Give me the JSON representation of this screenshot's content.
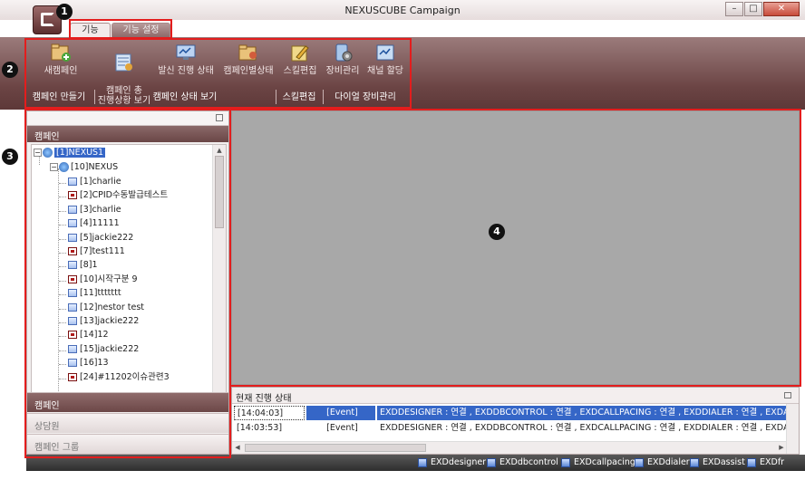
{
  "window": {
    "title": "NEXUSCUBE Campaign",
    "controls": {
      "minimize": "–",
      "maximize": "□",
      "close": "✕"
    }
  },
  "tabs": [
    {
      "label": "기능",
      "active": true
    },
    {
      "label": "기능 설정",
      "active": false
    }
  ],
  "ribbon": {
    "items": [
      {
        "label": "새캠페인",
        "icon": "new-campaign-icon"
      },
      {
        "label": "캠페인 총\n진행상황 보기",
        "icon": "campaign-overview-icon"
      },
      {
        "label": "발신 진행 상태",
        "icon": "outbound-status-icon"
      },
      {
        "label": "캠페인별상태",
        "icon": "campaign-status-icon"
      },
      {
        "label": "스킬편집",
        "icon": "skill-edit-icon"
      },
      {
        "label": "장비관리",
        "icon": "equipment-icon"
      },
      {
        "label": "채널 할당",
        "icon": "channel-assign-icon"
      }
    ],
    "groups": [
      {
        "label": "캠페인 만들기"
      },
      {
        "label": "캠페인 상태 보기"
      },
      {
        "label": "스킬편집"
      },
      {
        "label": "다이얼 장비관리"
      }
    ]
  },
  "left_panel": {
    "header": "캠페인",
    "tree": [
      {
        "label": "[1]NEXUS1",
        "level": 0,
        "kind": "root",
        "selected": true
      },
      {
        "label": "[10]NEXUS",
        "level": 1,
        "kind": "group"
      },
      {
        "label": "[1]charlie",
        "level": 2,
        "status": "blue"
      },
      {
        "label": "[2]CPID수동발급테스트",
        "level": 2,
        "status": "red"
      },
      {
        "label": "[3]charlie",
        "level": 2,
        "status": "blue"
      },
      {
        "label": "[4]11111",
        "level": 2,
        "status": "blue"
      },
      {
        "label": "[5]jackie222",
        "level": 2,
        "status": "blue"
      },
      {
        "label": "[7]test111",
        "level": 2,
        "status": "red"
      },
      {
        "label": "[8]1",
        "level": 2,
        "status": "blue"
      },
      {
        "label": "[10]시작구분 9",
        "level": 2,
        "status": "red"
      },
      {
        "label": "[11]ttttttt",
        "level": 2,
        "status": "blue"
      },
      {
        "label": "[12]nestor test",
        "level": 2,
        "status": "blue"
      },
      {
        "label": "[13]jackie222",
        "level": 2,
        "status": "blue"
      },
      {
        "label": "[14]12",
        "level": 2,
        "status": "red"
      },
      {
        "label": "[15]jackie222",
        "level": 2,
        "status": "blue"
      },
      {
        "label": "[16]13",
        "level": 2,
        "status": "blue"
      },
      {
        "label": "[24]#11202이슈관련3",
        "level": 2,
        "status": "red"
      }
    ],
    "nav": [
      {
        "label": "캠페인",
        "active": true
      },
      {
        "label": "상담원",
        "active": false
      },
      {
        "label": "캠페인 그룹",
        "active": false
      }
    ]
  },
  "status_panel": {
    "title": "현재 진행 상태",
    "rows": [
      {
        "time": "[14:04:03]",
        "type": "[Event]",
        "message": "EXDDESIGNER : 연결 , EXDDBCONTROL : 연결 , EXDCALLPACING : 연결 , EXDDIALER : 연결 , EXDASSIST",
        "selected": true
      },
      {
        "time": "[14:03:53]",
        "type": "[Event]",
        "message": "EXDDESIGNER : 연결 , EXDDBCONTROL : 연결 , EXDCALLPACING : 연결 , EXDDIALER : 연결 , EXDASSIST",
        "selected": false
      }
    ]
  },
  "taskbar": {
    "items": [
      "EXDdesigner",
      "EXDdbcontrol",
      "EXDcallpacing",
      "EXDdialer",
      "EXDassist",
      "EXDfr"
    ]
  },
  "annotations": [
    "1",
    "2",
    "3",
    "4"
  ]
}
